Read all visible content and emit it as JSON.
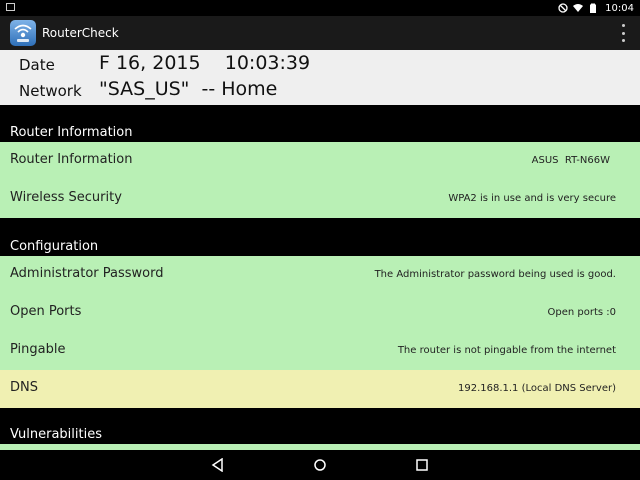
{
  "status_bar": {
    "time": "10:04"
  },
  "app_bar": {
    "title": "RouterCheck"
  },
  "info": {
    "date_label": "Date",
    "date_value": "F 16, 2015    10:03:39",
    "network_label": "Network",
    "network_value": "\"SAS_US\"  -- Home"
  },
  "sections": {
    "router_information": {
      "header": "Router Information",
      "rows": [
        {
          "label": "Router Information",
          "value": "ASUS  RT-N66W"
        },
        {
          "label": "Wireless Security",
          "value": "WPA2 is in use and is very secure"
        }
      ]
    },
    "configuration": {
      "header": "Configuration",
      "rows": [
        {
          "label": "Administrator Password",
          "value": "The Administrator password being used is good."
        },
        {
          "label": "Open Ports",
          "value": "Open ports :0"
        },
        {
          "label": "Pingable",
          "value": "The router is not pingable from the internet"
        },
        {
          "label": "DNS",
          "value": "192.168.1.1 (Local DNS Server)"
        }
      ]
    },
    "vulnerabilities": {
      "header": "Vulnerabilities"
    }
  },
  "colors": {
    "good": "#b9f0b5",
    "warning": "#f0f0b2"
  },
  "icons": [
    "screenshot-icon",
    "block-icon",
    "wifi-icon",
    "battery-icon",
    "back-icon",
    "home-icon",
    "recents-icon",
    "overflow-menu-icon",
    "routercheck-logo-icon"
  ]
}
